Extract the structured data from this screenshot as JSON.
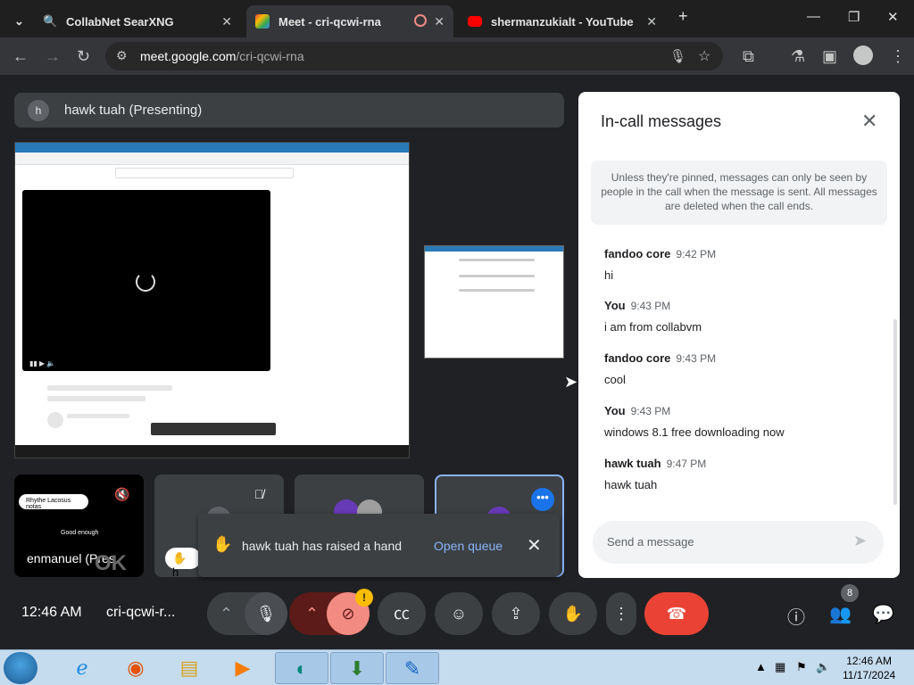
{
  "browser": {
    "tabs": [
      {
        "title": "CollabNet SearXNG",
        "active": false
      },
      {
        "title": "Meet - cri-qcwi-rna",
        "active": true
      },
      {
        "title": "shermanzukialt - YouTube",
        "active": false
      }
    ],
    "url_host": "meet.google.com",
    "url_path": "/cri-qcwi-rna"
  },
  "meet": {
    "presenter_initial": "h",
    "presenter_banner": "hawk tuah (Presenting)",
    "tiles": {
      "tile1_name": "enmanuel (Pres",
      "tile1_overlay": "OK",
      "tile1_bubble": "Rhythe Lacosus notas",
      "tile1_caption": "Good enough",
      "tile4_more": "•••",
      "hand_chip": "h"
    },
    "hand_toast": {
      "message": "hawk tuah has raised a hand",
      "action": "Open queue"
    },
    "panel": {
      "title": "In-call messages",
      "info": "Unless they're pinned, messages can only be seen by people in the call when the message is sent. All messages are deleted when the call ends.",
      "messages": [
        {
          "sender": "fandoo core",
          "time": "9:42 PM",
          "text": "hi"
        },
        {
          "sender": "You",
          "time": "9:43 PM",
          "text": "i am from collabvm"
        },
        {
          "sender": "fandoo core",
          "time": "9:43 PM",
          "text": "cool"
        },
        {
          "sender": "You",
          "time": "9:43 PM",
          "text": "windows 8.1 free downloading now"
        },
        {
          "sender": "hawk tuah",
          "time": "9:47 PM",
          "text": "hawk tuah"
        }
      ],
      "send_placeholder": "Send a message"
    },
    "bottom": {
      "clock": "12:46 AM",
      "meeting_code": "cri-qcwi-r...",
      "participant_count": "8",
      "camera_warning": "!"
    }
  },
  "taskbar": {
    "time": "12:46 AM",
    "date": "11/17/2024"
  },
  "colors": {
    "meet_bg": "#202124",
    "accent_blue": "#8ab4f8",
    "end_call_red": "#ea4335",
    "camera_off_red": "#f28b82"
  }
}
